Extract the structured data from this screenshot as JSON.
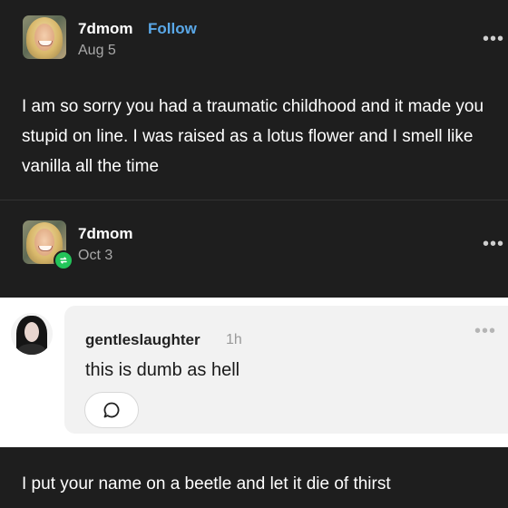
{
  "post1": {
    "username": "7dmom",
    "follow_label": "Follow",
    "date": "Aug 5",
    "more": "•••",
    "body": "I am so sorry you had a traumatic childhood and it made you stupid on line. I was raised as a lotus flower and I smell like vanilla all the time"
  },
  "post2": {
    "username": "7dmom",
    "date": "Oct 3",
    "more": "•••",
    "badge_icon": "reblog-icon",
    "badge_color": "#23c45a"
  },
  "reply": {
    "username": "gentleslaughter",
    "time": "1h",
    "text": "this is dumb as hell",
    "more": "•••",
    "reply_icon": "comment-bubble-icon"
  },
  "post3": {
    "body": "I put your name on a beetle and let it die of thirst"
  },
  "colors": {
    "background": "#1e1e1e",
    "accent_link": "#5aa8e8",
    "reply_panel": "#ffffff"
  }
}
